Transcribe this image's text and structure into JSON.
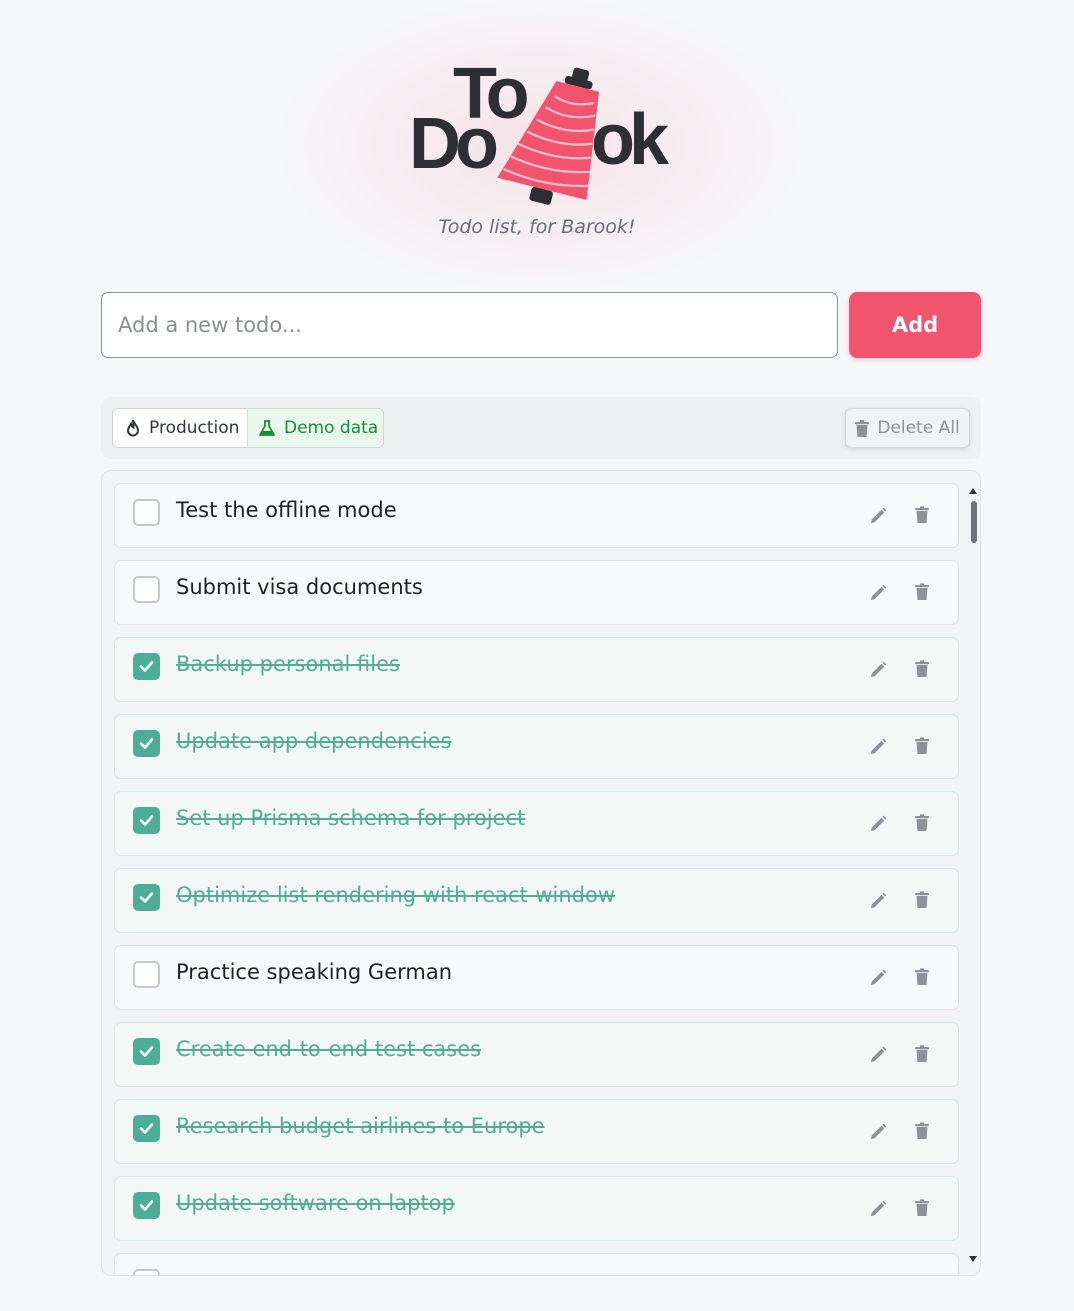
{
  "app": {
    "logo_text": "ToDo Barook",
    "tagline": "Todo list, for Barook!"
  },
  "add_form": {
    "placeholder": "Add a new todo...",
    "button_label": "Add"
  },
  "toolbar": {
    "modes": [
      {
        "label": "Production",
        "icon": "flame-icon",
        "selected": false
      },
      {
        "label": "Demo data",
        "icon": "flask-icon",
        "selected": true
      }
    ],
    "delete_all_label": "Delete All"
  },
  "colors": {
    "accent": "#f0546e",
    "done_green": "#4cae95",
    "demo_green": "#178c3a"
  },
  "todos": [
    {
      "text": "Test the offline mode",
      "done": false
    },
    {
      "text": "Submit visa documents",
      "done": false
    },
    {
      "text": "Backup personal files",
      "done": true
    },
    {
      "text": "Update app dependencies",
      "done": true
    },
    {
      "text": "Set up Prisma schema for project",
      "done": true
    },
    {
      "text": "Optimize list rendering with react-window",
      "done": true
    },
    {
      "text": "Practice speaking German",
      "done": false
    },
    {
      "text": "Create end-to-end test cases",
      "done": true
    },
    {
      "text": "Research budget airlines to Europe",
      "done": true
    },
    {
      "text": "Update software on laptop",
      "done": true
    },
    {
      "text": "",
      "done": false
    }
  ]
}
